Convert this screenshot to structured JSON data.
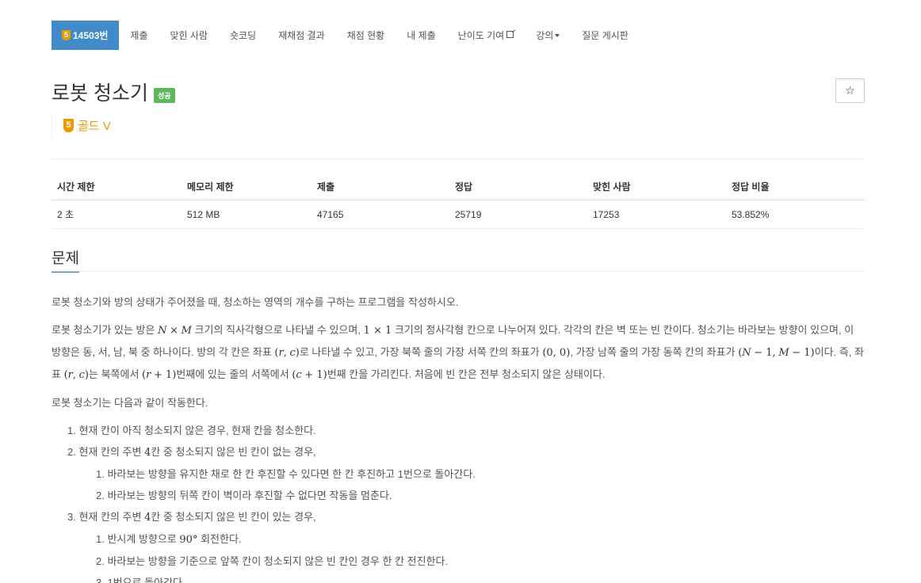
{
  "nav": {
    "problem_level": "5",
    "problem_id_label": "14503번",
    "items": [
      "제출",
      "맞힌 사람",
      "숏코딩",
      "재채점 결과",
      "채점 현황",
      "내 제출",
      "난이도 기여",
      "강의",
      "질문 게시판"
    ]
  },
  "problem": {
    "title": "로봇 청소기",
    "status_badge": "성공",
    "star": "☆",
    "tier_level": "5",
    "tier_label": "골드 V"
  },
  "info_table": {
    "headers": [
      "시간 제한",
      "메모리 제한",
      "제출",
      "정답",
      "맞힌 사람",
      "정답 비율"
    ],
    "values": [
      "2 초",
      "512 MB",
      "47165",
      "25719",
      "17253",
      "53.852%"
    ]
  },
  "section": {
    "title": "문제"
  },
  "colors": {
    "nav_active": "#428bca",
    "gold": "#ec9a00",
    "success": "#5cb85c",
    "section_underline": "#0076c0"
  }
}
